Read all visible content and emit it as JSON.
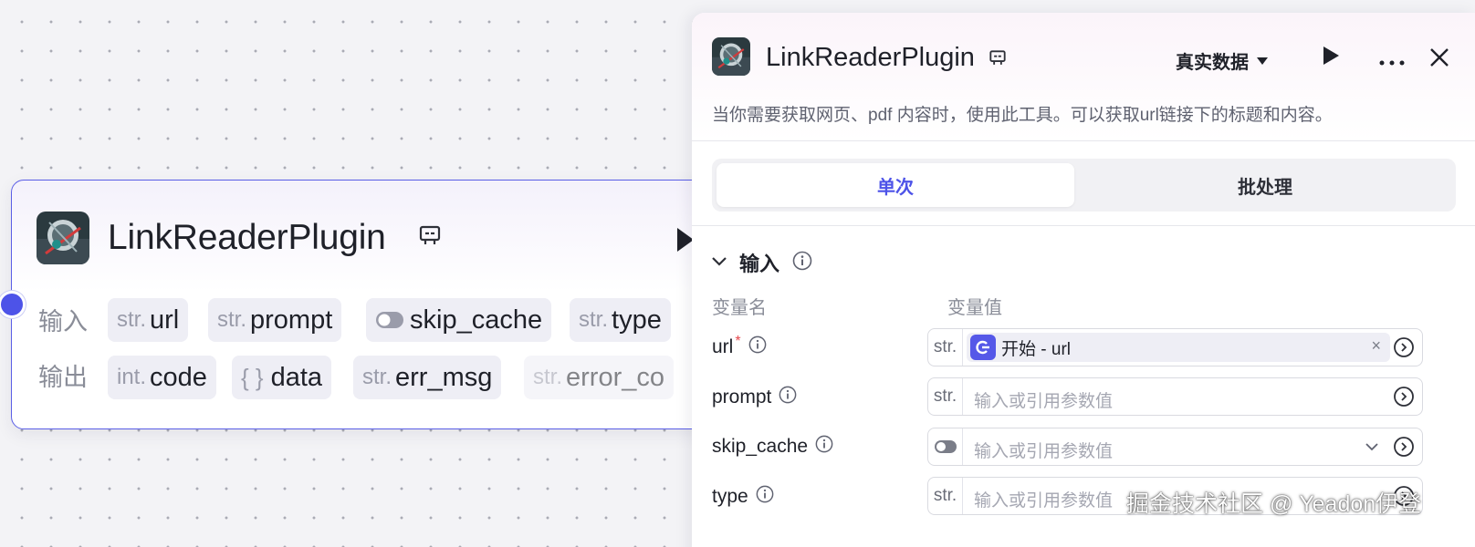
{
  "node": {
    "title": "LinkReaderPlugin",
    "inputs_label": "输入",
    "outputs_label": "输出",
    "inputs": [
      {
        "type": "str.",
        "name": "url"
      },
      {
        "type": "str.",
        "name": "prompt"
      },
      {
        "type": "toggle",
        "name": "skip_cache"
      },
      {
        "type": "str.",
        "name": "type"
      }
    ],
    "outputs": [
      {
        "type": "int.",
        "name": "code"
      },
      {
        "type": "{ }",
        "name": "data"
      },
      {
        "type": "str.",
        "name": "err_msg"
      },
      {
        "type": "str.",
        "name": "error_co"
      }
    ]
  },
  "panel": {
    "title": "LinkReaderPlugin",
    "data_mode": "真实数据",
    "description": "当你需要获取网页、pdf 内容时，使用此工具。可以获取url链接下的标题和内容。",
    "tabs": [
      {
        "label": "单次",
        "active": true
      },
      {
        "label": "批处理",
        "active": false
      }
    ],
    "section_label": "输入",
    "col_name": "变量名",
    "col_value": "变量值",
    "params": [
      {
        "name": "url",
        "required": true,
        "type": "str.",
        "ref_value": "开始 - url"
      },
      {
        "name": "prompt",
        "required": false,
        "type": "str.",
        "placeholder": "输入或引用参数值"
      },
      {
        "name": "skip_cache",
        "required": false,
        "type": "toggle",
        "placeholder": "输入或引用参数值"
      },
      {
        "name": "type",
        "required": false,
        "type": "str.",
        "placeholder": "输入或引用参数值"
      }
    ],
    "required_mark": "*",
    "clear_symbol": "×"
  },
  "watermark": "掘金技术社区 @ Yeadon伊登",
  "colors": {
    "accent": "#4d53e8",
    "required": "#e5484d"
  }
}
